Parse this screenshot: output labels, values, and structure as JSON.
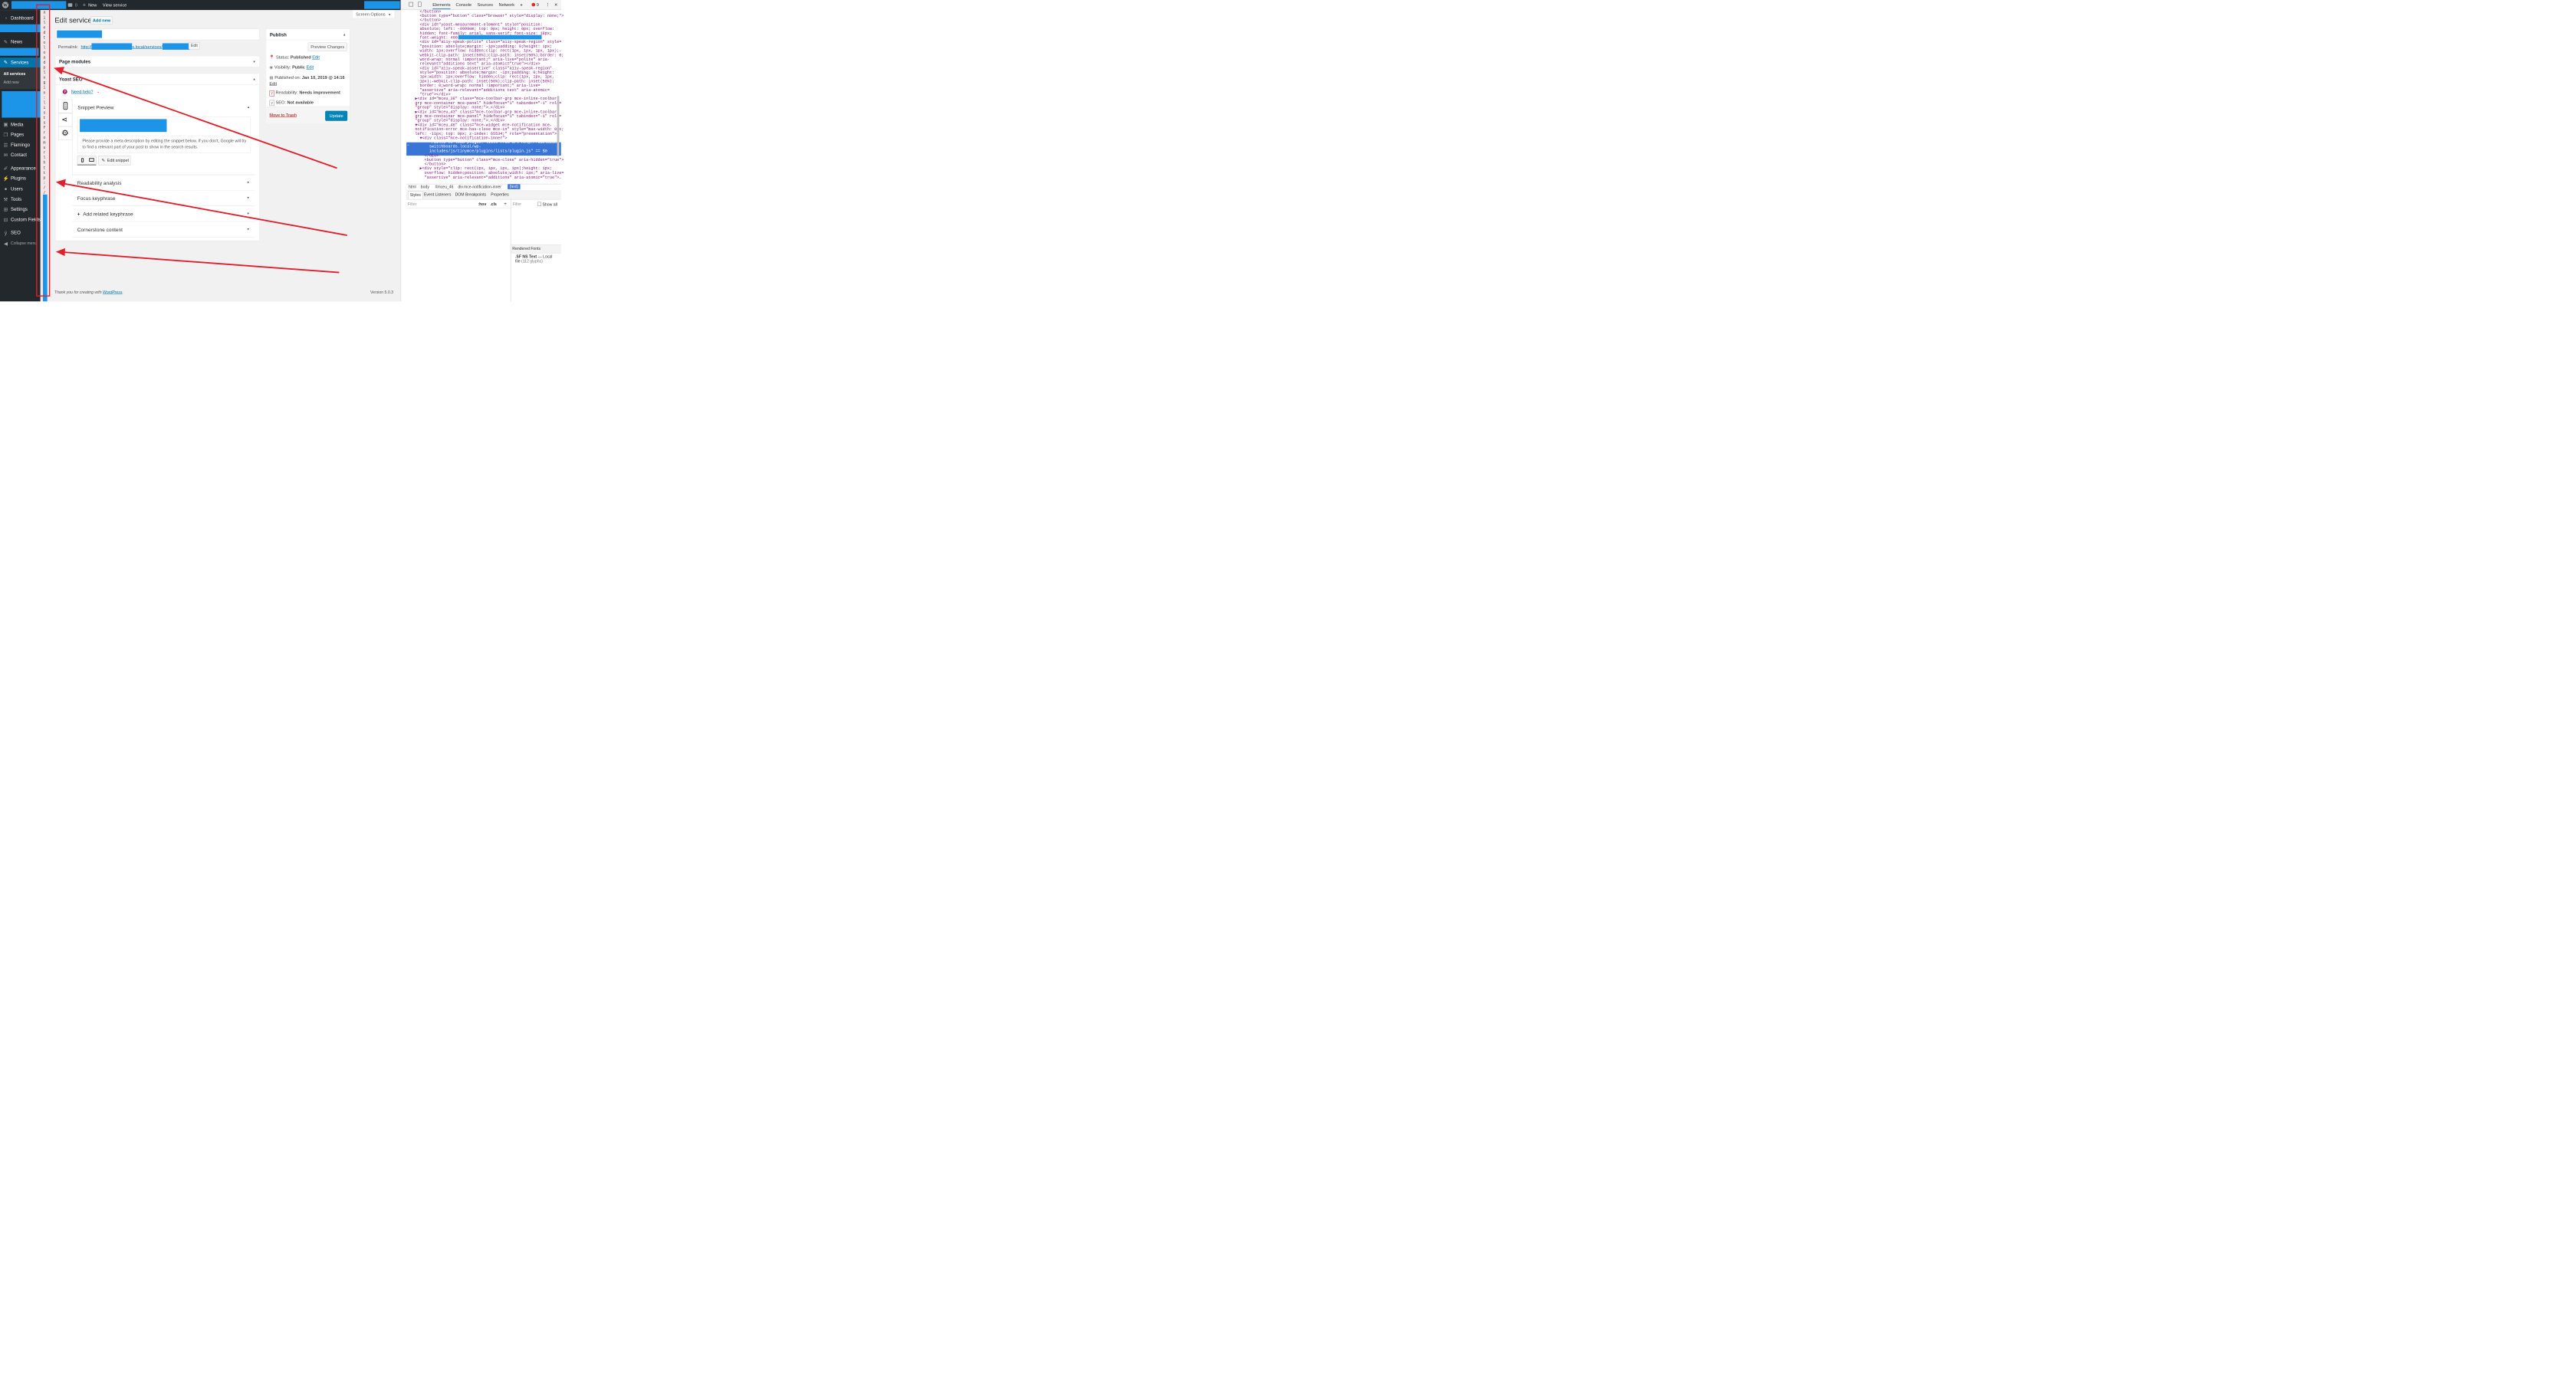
{
  "admin_bar": {
    "logo_glyph": "W",
    "comments_count": "0",
    "new_label": "New",
    "view_label": "View service"
  },
  "sidebar": {
    "dashboard": "Dashboard",
    "news": "News",
    "services": "Services",
    "sub_all": "All services",
    "sub_add": "Add new",
    "media": "Media",
    "pages": "Pages",
    "flamingo": "Flamingo",
    "contact": "Contact",
    "appearance": "Appearance",
    "plugins": "Plugins",
    "users": "Users",
    "tools": "Tools",
    "settings": "Settings",
    "custom_fields": "Custom Fields",
    "seo": "SEO",
    "collapse": "Collapse menu"
  },
  "error_strip_chars": [
    "a",
    "i",
    "l",
    "e",
    "d",
    "t",
    "o",
    "l",
    "o",
    "a",
    "d",
    "p",
    "l",
    "u",
    "g",
    "i",
    "n",
    ":",
    "l",
    "i",
    "s",
    "t",
    "s",
    "f",
    "r",
    "o",
    "m",
    "u",
    "r",
    "l",
    "h",
    "t",
    "t",
    "p",
    ":",
    "/",
    "/"
  ],
  "page": {
    "title": "Edit service",
    "add_new": "Add new",
    "screen_options": "Screen Options",
    "permalink_label": "Permalink:",
    "permalink_prefix": "http://",
    "permalink_mid": "s.local/services/",
    "permalink_edit": "Edit"
  },
  "modules": {
    "page_modules": "Page modules",
    "yoast": "Yoast SEO",
    "need_help": "Need help?",
    "snippet_preview": "Snippet Preview",
    "snippet_text": "Please provide a meta description by editing the snippet below. If you don't, Google will try to find a relevant part of your post to show in the search results.",
    "edit_snippet": "Edit snippet",
    "readability": "Readability analysis",
    "focus": "Focus keyphrase",
    "related": "Add related keyphrase",
    "cornerstone": "Cornerstone content"
  },
  "publish": {
    "heading": "Publish",
    "preview": "Preview Changes",
    "status_label": "Status:",
    "status_value": "Published",
    "visibility_label": "Visibility:",
    "visibility_value": "Public",
    "published_label": "Published on:",
    "published_value": "Jan 10, 2019 @ 14:16",
    "edit": "Edit",
    "readability_label": "Readability:",
    "readability_value": "Needs improvement",
    "seo_label": "SEO:",
    "seo_value": "Not available",
    "trash": "Move to Trash",
    "update": "Update"
  },
  "footer": {
    "thanks": "Thank you for creating with",
    "wp": "WordPress",
    "period": ".",
    "version": "Version 5.0.3"
  },
  "devtools": {
    "tabs": [
      "Elements",
      "Console",
      "Sources",
      "Network"
    ],
    "more": "»",
    "error_count": "9",
    "code_lines": [
      "  </button>",
      "  <button type=\"button\" class=\"browser\" style=\"display: none;\">",
      "  </button>",
      "  <div id=\"yoast-measurement-element\" style=\"position:",
      "  absolute; left: -9999em; top: 0px; height: 0px; overflow:",
      "  hidden; font-family: arial, sans-serif; font-size: 18px;",
      "  font-weight: 400;\"                           </div>",
      "  <div id=\"a11y-speak-polite\" class=\"a11y-speak-region\" style=",
      "  \"position: absolute;margin: -1px;padding: 0;height: 1px;",
      "  width: 1px;overflow: hidden;clip: rect(1px, 1px, 1px, 1px);-",
      "  webkit-clip-path: inset(50%);clip-path: inset(50%);border: 0;",
      "  word-wrap: normal !important;\" aria-live=\"polite\" aria-",
      "  relevant=\"additions text\" aria-atomic=\"true\"></div>",
      "  <div id=\"a11y-speak-assertive\" class=\"a11y-speak-region\"",
      "  style=\"position: absolute;margin: -1px;padding: 0;height:",
      "  1px;width: 1px;overflow: hidden;clip: rect(1px, 1px, 1px,",
      "  1px);-webkit-clip-path: inset(50%);clip-path: inset(50%);",
      "  border: 0;word-wrap: normal !important;\" aria-live=",
      "  \"assertive\" aria-relevant=\"additions text\" aria-atomic=",
      "  \"true\"></div>",
      "▶<div id=\"mceu_38\" class=\"mce-toolbar-grp mce-inline-toolbar-",
      "grp mce-container mce-panel\" hidefocus=\"1\" tabindex=\"-1\" role=",
      "\"group\" style=\"display: none;\">…</div>",
      "▶<div id=\"mceu_43\" class=\"mce-toolbar-grp mce-inline-toolbar-",
      "grp mce-container mce-panel\" hidefocus=\"1\" tabindex=\"-1\" role=",
      "\"group\" style=\"display: none;\">…</div>",
      "▼<div id=\"mceu_46\" class=\"mce-widget mce-notification mce-",
      "notification-error mce-has-close mce-in\" style=\"max-width: 0px;",
      "left: -11px; top: 0px; z-index: 65534;\" role=\"presentation\">",
      "  ▼<div class=\"mce-notification-inner\">",
      "      \"Failed to load plugin: lists from url http://adelaide-",
      "      switchboards.local/wp-",
      "      includes/js/tinymce/plugins/lists/plugin.js\" == $0",
      "    </div>",
      "    <button type=\"button\" class=\"mce-close\" aria-hidden=\"true\">",
      "    </button>",
      "  ▶<div style=\"clip: rect(1px, 1px, 1px, 1px);height: 1px;",
      "    overflow: hidden;position: absolute;width: 1px;\" aria-live=",
      "    \"assertive\" aria-relevant=\"additions\" aria-atomic=\"true\">…"
    ],
    "ellipsis": "…",
    "breadcrumb": [
      "html",
      "body",
      "#mceu_46",
      "div.mce-notification-inner",
      "(text)"
    ],
    "styles_tabs": [
      "Styles",
      "Event Listeners",
      "DOM Breakpoints",
      "Properties"
    ],
    "filter": "Filter",
    "hov": ":hov",
    "cls": ".cls",
    "plus": "+",
    "filter2": "Filter",
    "show_all": "Show all",
    "rendered_fonts": "Rendered Fonts",
    "font_name": ".SF NS Text",
    "font_dash": "—",
    "font_local": "Local",
    "font_file": "file",
    "font_glyphs": "(112 glyphs)"
  },
  "colors": {
    "wp_blue": "#0073aa",
    "admin_dark": "#23282d",
    "redaction": "#1c94e8",
    "arrow_red": "#e0202c",
    "devtools_selection": "#3875d7"
  }
}
